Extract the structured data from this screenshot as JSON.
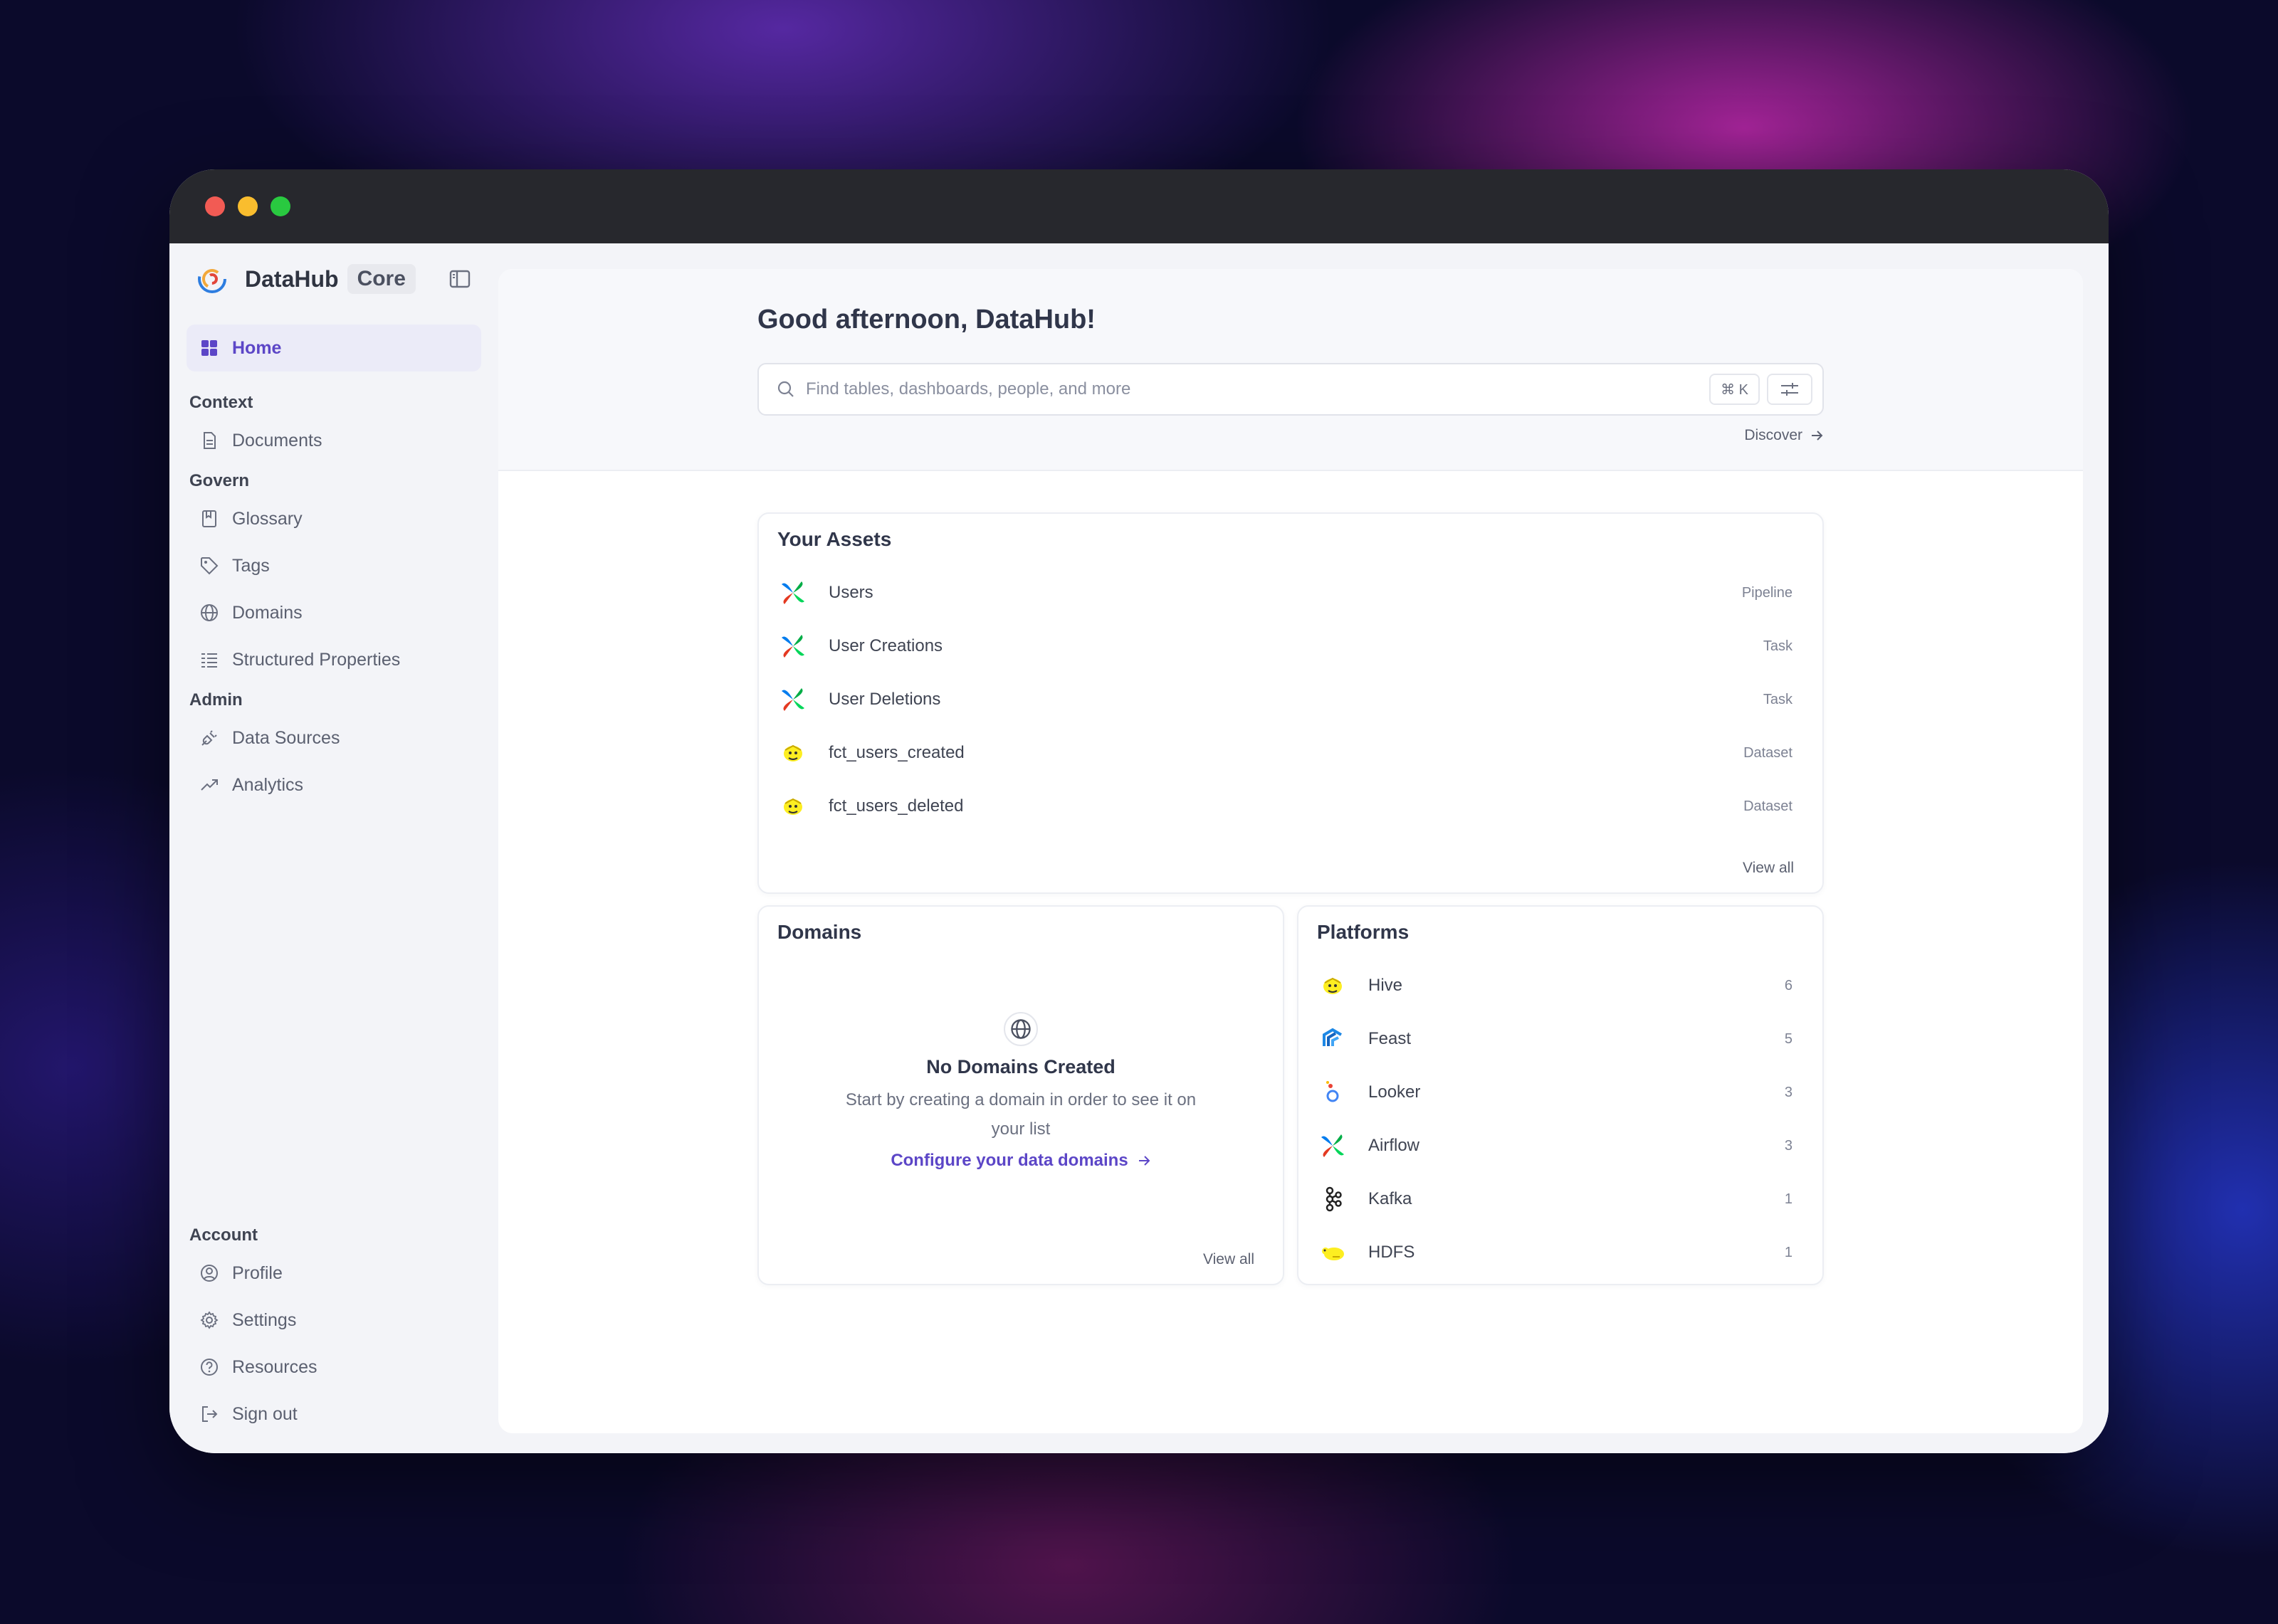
{
  "brand": {
    "name": "DataHub",
    "badge": "Core"
  },
  "sidebar": {
    "home": "Home",
    "sections": {
      "context": "Context",
      "govern": "Govern",
      "admin": "Admin",
      "account": "Account"
    },
    "items": {
      "documents": "Documents",
      "glossary": "Glossary",
      "tags": "Tags",
      "domains": "Domains",
      "structured_properties": "Structured Properties",
      "data_sources": "Data Sources",
      "analytics": "Analytics",
      "profile": "Profile",
      "settings": "Settings",
      "resources": "Resources",
      "sign_out": "Sign out"
    }
  },
  "header": {
    "greeting": "Good afternoon, DataHub!",
    "search_placeholder": "Find tables, dashboards, people, and more",
    "shortcut": "⌘ K",
    "discover": "Discover"
  },
  "your_assets": {
    "title": "Your Assets",
    "items": [
      {
        "name": "Users",
        "type": "Pipeline",
        "icon": "airflow-icon"
      },
      {
        "name": "User Creations",
        "type": "Task",
        "icon": "airflow-icon"
      },
      {
        "name": "User Deletions",
        "type": "Task",
        "icon": "airflow-icon"
      },
      {
        "name": "fct_users_created",
        "type": "Dataset",
        "icon": "hive-icon"
      },
      {
        "name": "fct_users_deleted",
        "type": "Dataset",
        "icon": "hive-icon"
      }
    ],
    "view_all": "View all"
  },
  "domains": {
    "title": "Domains",
    "empty_title": "No Domains Created",
    "empty_desc": "Start by creating a domain in order to see it on your list",
    "configure_link": "Configure your data domains",
    "view_all": "View all"
  },
  "platforms": {
    "title": "Platforms",
    "items": [
      {
        "name": "Hive",
        "count": "6",
        "icon": "hive-icon"
      },
      {
        "name": "Feast",
        "count": "5",
        "icon": "feast-icon"
      },
      {
        "name": "Looker",
        "count": "3",
        "icon": "looker-icon"
      },
      {
        "name": "Airflow",
        "count": "3",
        "icon": "airflow-icon"
      },
      {
        "name": "Kafka",
        "count": "1",
        "icon": "kafka-icon"
      },
      {
        "name": "HDFS",
        "count": "1",
        "icon": "hdfs-icon"
      }
    ]
  },
  "colors": {
    "accent": "#5c46c7",
    "active_bg": "#ebebf8"
  }
}
